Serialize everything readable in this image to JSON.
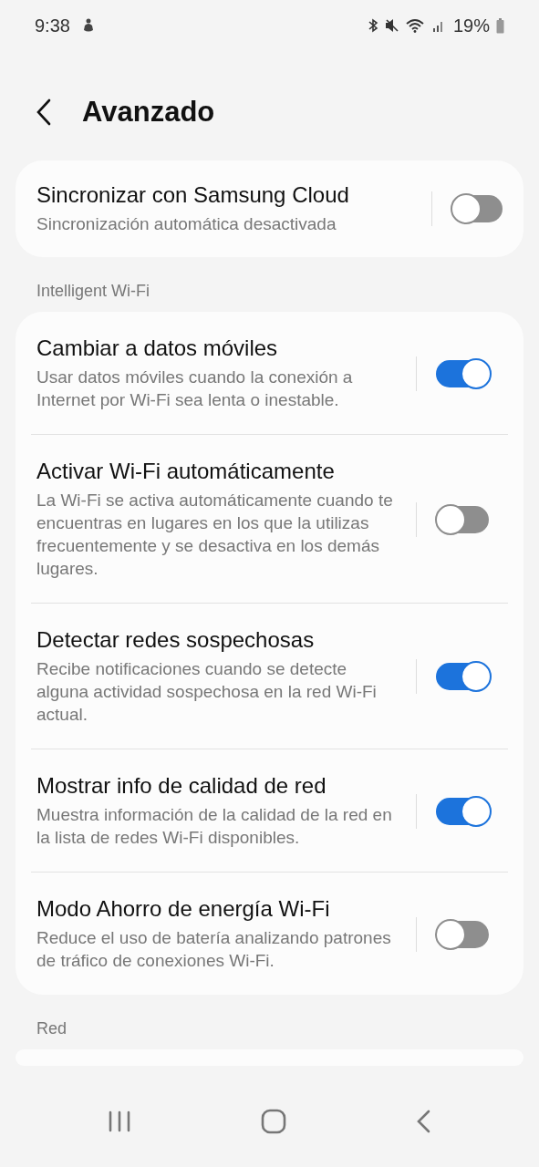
{
  "status_bar": {
    "time": "9:38",
    "battery": "19%"
  },
  "header": {
    "title": "Avanzado"
  },
  "sync": {
    "title": "Sincronizar con Samsung Cloud",
    "subtitle": "Sincronización automática desactivada",
    "on": false
  },
  "sections": [
    {
      "title": "Intelligent Wi-Fi",
      "items": [
        {
          "title": "Cambiar a datos móviles",
          "subtitle": "Usar datos móviles cuando la conexión a Internet por Wi-Fi sea lenta o inestable.",
          "on": true
        },
        {
          "title": "Activar Wi-Fi automáticamente",
          "subtitle": "La Wi-Fi se activa automáticamente cuando te encuentras en lugares en los que la utilizas frecuentemente y se desactiva en los demás lugares.",
          "on": false
        },
        {
          "title": "Detectar redes sospechosas",
          "subtitle": "Recibe notificaciones cuando se detecte alguna actividad sospechosa en la red Wi-Fi actual.",
          "on": true
        },
        {
          "title": "Mostrar info de calidad de red",
          "subtitle": "Muestra información de la calidad de la red en la lista de redes Wi-Fi disponibles.",
          "on": true
        },
        {
          "title": "Modo Ahorro de energía Wi-Fi",
          "subtitle": "Reduce el uso de batería analizando patrones de tráfico de conexiones Wi-Fi.",
          "on": false
        }
      ]
    },
    {
      "title": "Red"
    }
  ]
}
